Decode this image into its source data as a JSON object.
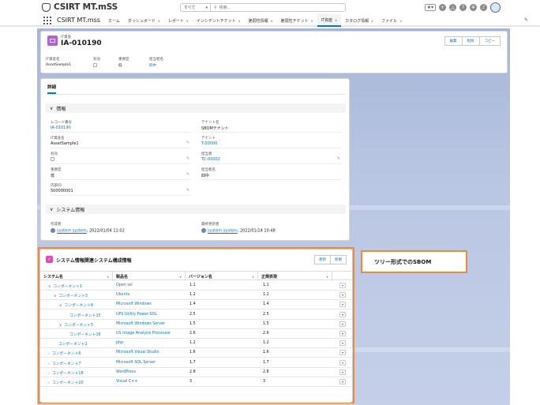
{
  "app": {
    "logo_text": "CSIRT MT.mSS",
    "app_name": "CSIRT MT.mss"
  },
  "search": {
    "scope": "すべて",
    "placeholder": "検索..."
  },
  "nav": {
    "items": [
      {
        "label": "ホーム",
        "chevron": false,
        "active": false
      },
      {
        "label": "ダッシュボード",
        "chevron": true,
        "active": false
      },
      {
        "label": "レポート",
        "chevron": true,
        "active": false
      },
      {
        "label": "インシデントチケット",
        "chevron": true,
        "active": false
      },
      {
        "label": "脆弱性情報",
        "chevron": true,
        "active": false
      },
      {
        "label": "脆弱性チケット",
        "chevron": true,
        "active": false
      },
      {
        "label": "IT資産",
        "chevron": true,
        "active": true
      },
      {
        "label": "カタログ情報",
        "chevron": true,
        "active": false
      },
      {
        "label": "ファイル",
        "chevron": true,
        "active": false
      }
    ]
  },
  "header": {
    "type": "IT資産",
    "title": "IA-010190",
    "buttons": {
      "edit": "編集",
      "delete": "削除",
      "copy": "コピー"
    },
    "fields": [
      {
        "label": "IT資産名",
        "value": "AssetSample1",
        "kind": "text"
      },
      {
        "label": "有効",
        "value": "",
        "kind": "check"
      },
      {
        "label": "重要度",
        "value": "低",
        "kind": "text"
      },
      {
        "label": "担当者名",
        "value": "四中",
        "kind": "link"
      }
    ]
  },
  "detail": {
    "tab": "詳細",
    "section_info": "情報",
    "left_fields": [
      {
        "label": "レコード番号",
        "value": "IA-010190",
        "link": true,
        "edit": false
      },
      {
        "label": "IT資産名",
        "value": "AssetSample1",
        "link": false,
        "edit": true
      },
      {
        "label": "有効",
        "value": "",
        "link": false,
        "edit": true,
        "check": true
      },
      {
        "label": "重要度",
        "value": "低",
        "link": false,
        "edit": true
      },
      {
        "label": "内部ID",
        "value": "500000001",
        "link": false,
        "edit": true
      }
    ],
    "right_fields": [
      {
        "label": "テナント名",
        "value": "SBOMテナント",
        "link": false,
        "edit": false
      },
      {
        "label": "テナント",
        "value": "T-00000",
        "link": true,
        "edit": false
      },
      {
        "label": "担当者",
        "value": "TC-00002",
        "link": true,
        "edit": true
      },
      {
        "label": "担当者名",
        "value": "四中",
        "link": false,
        "edit": false
      }
    ],
    "section_system": "システム情報",
    "created_label": "作成者",
    "created_user": "system system",
    "created_at": "2022/01/04 11:02",
    "modified_label": "最終更新者",
    "modified_user": "system system",
    "modified_at": "2022/01/14 10:48"
  },
  "related": {
    "title": "システム情報関連システム構成情報",
    "buttons": {
      "update": "更新",
      "new": "新規"
    },
    "columns": [
      "システム名",
      "製品名",
      "バージョン名",
      "正規表現"
    ],
    "rows": [
      {
        "name": "コンポーネント1",
        "indent": 0,
        "toggle": "∨",
        "product": "Open ssl",
        "version": "1.1",
        "regex": "1.1"
      },
      {
        "name": "コンポーネント3",
        "indent": 1,
        "toggle": "∨",
        "product": "Ubuntu",
        "version": "1.2",
        "regex": "1.2"
      },
      {
        "name": "コンポーネント4",
        "indent": 2,
        "toggle": "∨",
        "product": "Microsoft Windows",
        "version": "1.4",
        "regex": "1.4"
      },
      {
        "name": "コンポーネント15",
        "indent": 3,
        "toggle": "",
        "product": "UPS Utility Power-SOL",
        "version": "2.5",
        "regex": "2.5"
      },
      {
        "name": "コンポーネント5",
        "indent": 2,
        "toggle": "∨",
        "product": "Microsoft Windows Server",
        "version": "1.5",
        "regex": "1.5"
      },
      {
        "name": "コンポーネント16",
        "indent": 3,
        "toggle": "",
        "product": "US Image Analysis Processor",
        "version": "2.6",
        "regex": "2.6"
      },
      {
        "name": "コンポーネント2",
        "indent": 1,
        "toggle": "",
        "product": "php",
        "version": "1.2",
        "regex": "1.2"
      },
      {
        "name": "コンポーネント6",
        "indent": 0,
        "toggle": "›",
        "product": "Microsoft Visual Studio",
        "version": "1.6",
        "regex": "1.6"
      },
      {
        "name": "コンポーネント7",
        "indent": 0,
        "toggle": "›",
        "product": "Microsoft SQL Server",
        "version": "1.7",
        "regex": "1.7"
      },
      {
        "name": "コンポーネント18",
        "indent": 0,
        "toggle": "›",
        "product": "WordPress",
        "version": "2.8",
        "regex": "2.8"
      },
      {
        "name": "コンポーネント20",
        "indent": 0,
        "toggle": "›",
        "product": "Visual C++",
        "version": "3",
        "regex": "3"
      }
    ]
  },
  "callout": {
    "text": "ツリー形式でのSBOM"
  },
  "colors": {
    "accent": "#0176d3",
    "callout_border": "#f28b2f",
    "header_icon": "#b55fd0",
    "related_icon": "#e04fb0"
  }
}
